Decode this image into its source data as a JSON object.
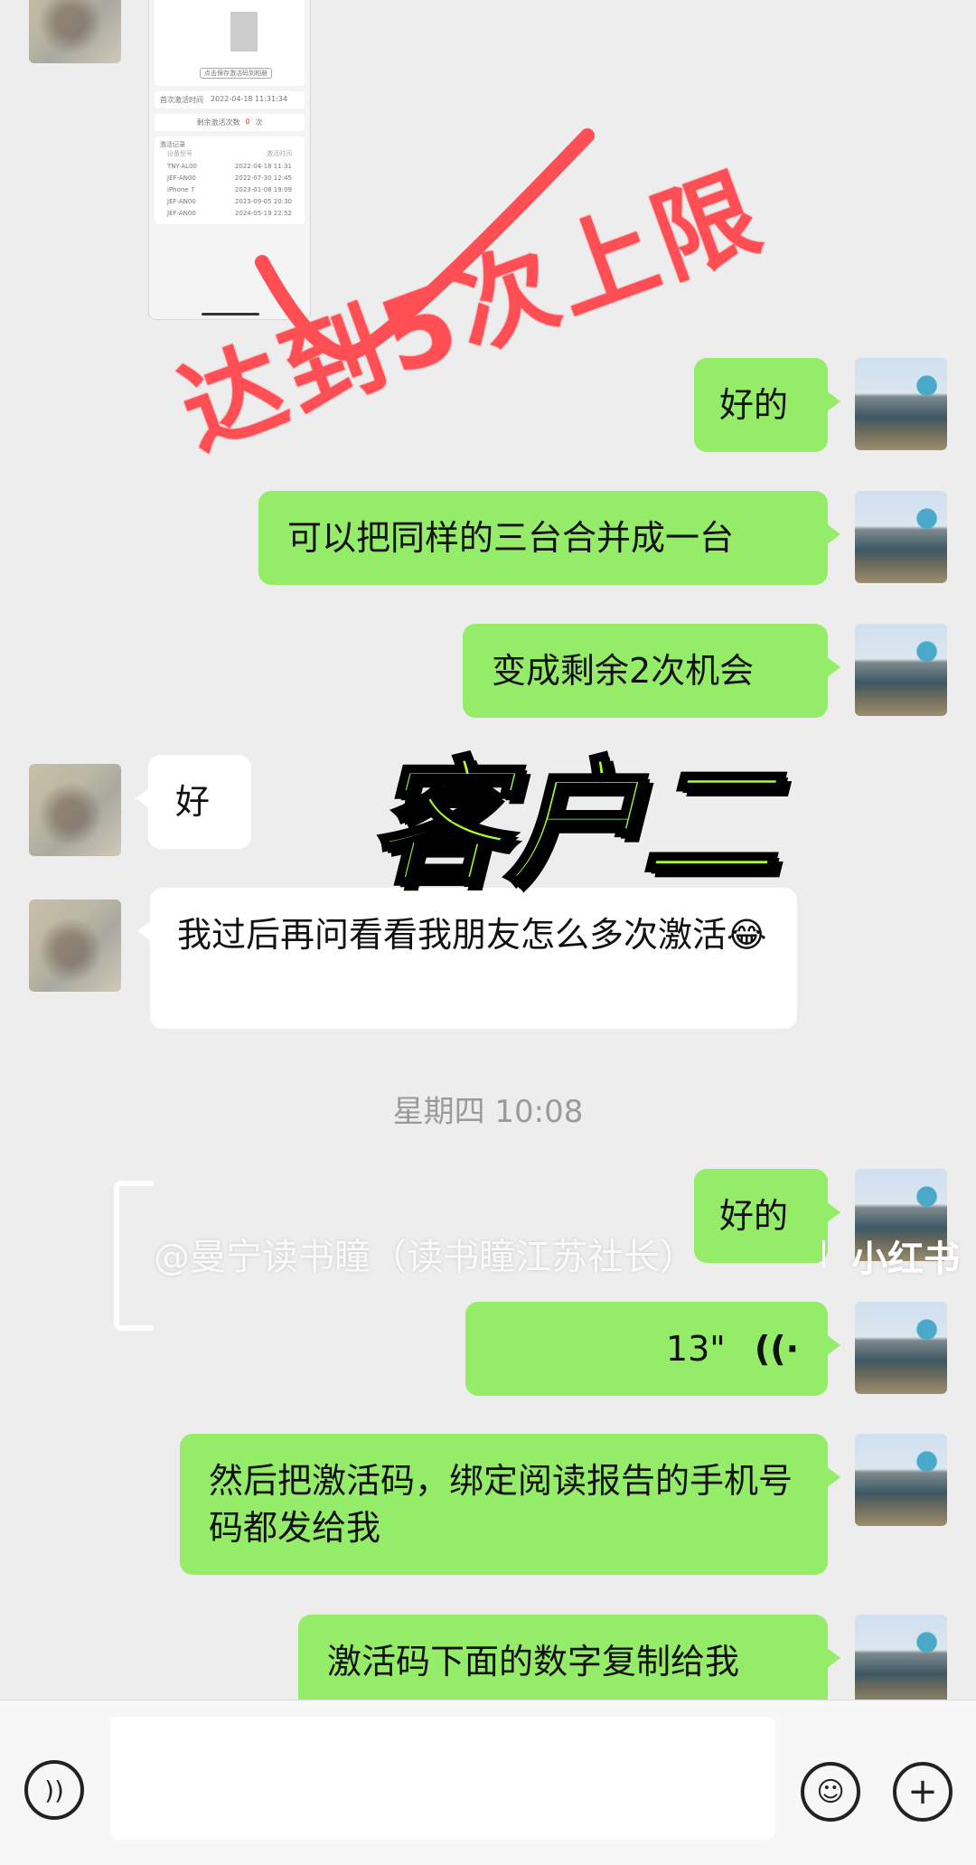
{
  "screenshot_card": {
    "button_text": "点击保存激活码到相册",
    "first_activation_label": "首次激活时间",
    "first_activation_value": "2022-04-18 11:31:34",
    "remaining_label": "剩余激活次数",
    "remaining_value": "0",
    "remaining_unit": "次",
    "records_title": "激活记录",
    "records_header": [
      "设备型号",
      "激活时间"
    ],
    "records": [
      [
        "TNY-AL00",
        "2022-04-18 11:31"
      ],
      [
        "JEF-AN00",
        "2022-07-30 12:45"
      ],
      [
        "iPhone 7",
        "2023-01-08 19:09"
      ],
      [
        "JEF-AN00",
        "2023-09-05 20:30"
      ],
      [
        "JEF-AN00",
        "2024-05-19 22:52"
      ]
    ]
  },
  "overlays": {
    "red_annotation": "达到5次上限",
    "green_caption": "客户二",
    "watermark": "@曼宁读书瞳（读书瞳江苏社长）",
    "watermark_brand": "小红书"
  },
  "messages": [
    {
      "side": "right",
      "text": "好的"
    },
    {
      "side": "right",
      "text": "可以把同样的三台合并成一台"
    },
    {
      "side": "right",
      "text": "变成剩余2次机会"
    },
    {
      "side": "left",
      "text": "好"
    },
    {
      "side": "left",
      "text": "我过后再问看看我朋友怎么多次激活😂"
    },
    {
      "side": "right",
      "text": "好的"
    },
    {
      "side": "right",
      "voice_duration": "13\""
    },
    {
      "side": "right",
      "text": "然后把激活码，绑定阅读报告的手机号码都发给我"
    },
    {
      "side": "right",
      "text": "激活码下面的数字复制给我"
    }
  ],
  "timestamp": "星期四 10:08",
  "input_bar": {
    "voice_icon": "voice-icon",
    "emoji_icon": "emoji-icon",
    "plus_icon": "plus-icon"
  },
  "colors": {
    "green_bubble": "#95ec69",
    "white_bubble": "#ffffff",
    "background": "#ededed",
    "red_overlay": "#ff4f55",
    "green_overlay": "#a6ff2e"
  }
}
